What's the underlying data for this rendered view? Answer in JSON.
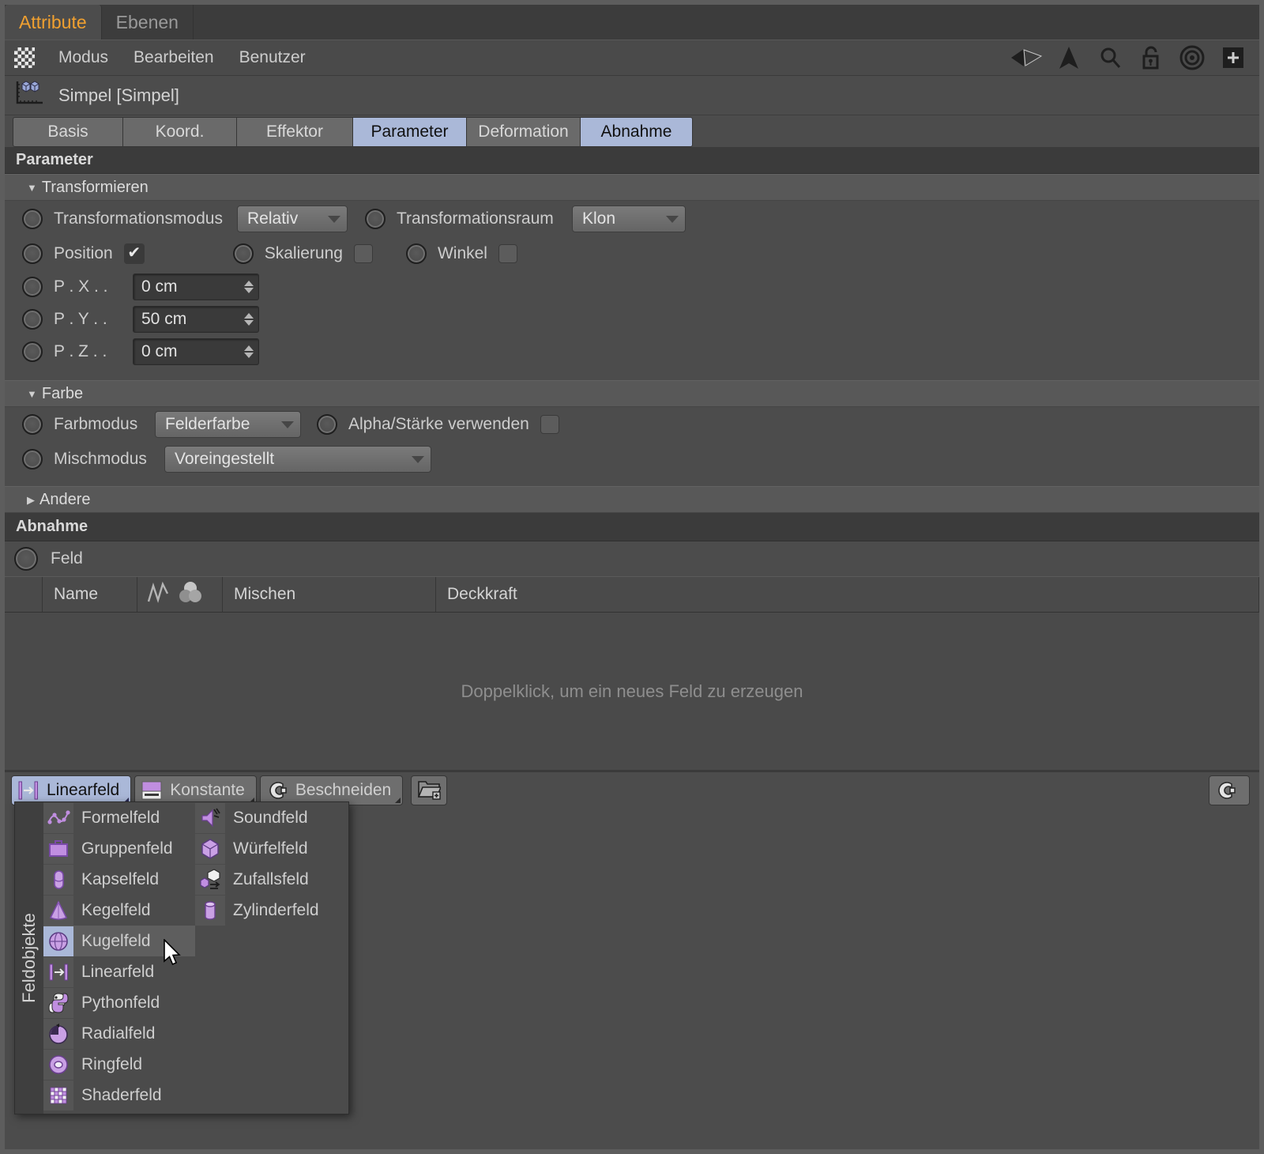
{
  "window": {
    "tabs": [
      {
        "label": "Attribute",
        "active": true
      },
      {
        "label": "Ebenen",
        "active": false
      }
    ]
  },
  "menubar": {
    "icon": "grid-icon",
    "items": [
      "Modus",
      "Bearbeiten",
      "Benutzer"
    ],
    "right_icons": [
      "back-arrow-icon",
      "up-arrow-icon",
      "search-icon",
      "lock-open-icon",
      "target-icon",
      "add-panel-icon"
    ]
  },
  "object_header": {
    "icon": "mograph-simple-effector-icon",
    "title": "Simpel [Simpel]"
  },
  "tabstrip": [
    {
      "label": "Basis",
      "active": false
    },
    {
      "label": "Koord.",
      "active": false
    },
    {
      "label": "Effektor",
      "active": false
    },
    {
      "label": "Parameter",
      "active": true
    },
    {
      "label": "Deformation",
      "active": false
    },
    {
      "label": "Abnahme",
      "active": true
    }
  ],
  "parameter_section": {
    "title": "Parameter",
    "transform": {
      "title": "Transformieren",
      "expanded": true,
      "mode_label": "Transformationsmodus",
      "mode_value": "Relativ",
      "space_label": "Transformationsraum",
      "space_value": "Klon",
      "position_label": "Position",
      "position_checked": true,
      "scale_label": "Skalierung",
      "scale_checked": false,
      "angle_label": "Winkel",
      "angle_checked": false,
      "fields": [
        {
          "label": "P . X  . .",
          "value": "0 cm"
        },
        {
          "label": "P . Y  . .",
          "value": "50 cm"
        },
        {
          "label": "P . Z  . .",
          "value": "0 cm"
        }
      ]
    },
    "color": {
      "title": "Farbe",
      "expanded": true,
      "colormode_label": "Farbmodus",
      "colormode_value": "Felderfarbe",
      "alpha_label": "Alpha/Stärke verwenden",
      "alpha_checked": false,
      "blendmode_label": "Mischmodus",
      "blendmode_value": "Voreingestellt"
    },
    "other": {
      "title": "Andere",
      "expanded": false
    }
  },
  "falloff_section": {
    "title": "Abnahme",
    "field_label": "Feld",
    "columns": [
      "",
      "Name",
      "",
      "Mischen",
      "Deckkraft"
    ],
    "empty_message": "Doppelklick, um ein neues Feld zu erzeugen"
  },
  "bottom_toolbar": {
    "tabs": [
      {
        "label": "Linearfeld",
        "icon": "linear-field-icon",
        "active": true
      },
      {
        "label": "Konstante",
        "icon": "constant-layer-icon",
        "active": false
      },
      {
        "label": "Beschneiden",
        "icon": "clamp-layer-icon",
        "active": false
      }
    ],
    "folder_button_icon": "new-folder-icon",
    "right_button_icon": "clamp-layer-icon"
  },
  "popup_menu": {
    "rail_label": "Feldobjekte",
    "columns": [
      {
        "items": [
          {
            "label": "Formelfeld",
            "icon": "formula-field-icon",
            "selected": false
          },
          {
            "label": "Gruppenfeld",
            "icon": "group-field-icon",
            "selected": false
          },
          {
            "label": "Kapselfeld",
            "icon": "capsule-field-icon",
            "selected": false
          },
          {
            "label": "Kegelfeld",
            "icon": "cone-field-icon",
            "selected": false
          },
          {
            "label": "Kugelfeld",
            "icon": "sphere-field-icon",
            "selected": true
          },
          {
            "label": "Linearfeld",
            "icon": "linear-field-icon",
            "selected": false
          },
          {
            "label": "Pythonfeld",
            "icon": "python-field-icon",
            "selected": false
          },
          {
            "label": "Radialfeld",
            "icon": "radial-field-icon",
            "selected": false
          },
          {
            "label": "Ringfeld",
            "icon": "torus-field-icon",
            "selected": false
          },
          {
            "label": "Shaderfeld",
            "icon": "shader-field-icon",
            "selected": false
          }
        ]
      },
      {
        "items": [
          {
            "label": "Soundfeld",
            "icon": "sound-field-icon",
            "selected": false
          },
          {
            "label": "Würfelfeld",
            "icon": "box-field-icon",
            "selected": false
          },
          {
            "label": "Zufallsfeld",
            "icon": "random-field-icon",
            "selected": false
          },
          {
            "label": "Zylinderfeld",
            "icon": "cylinder-field-icon",
            "selected": false
          }
        ]
      }
    ]
  },
  "colors": {
    "accent_tab": "#f0a030",
    "active_tab": "#aab8d8",
    "panel_bg": "#4c4c4c",
    "field_purple": "#c08ee0"
  }
}
